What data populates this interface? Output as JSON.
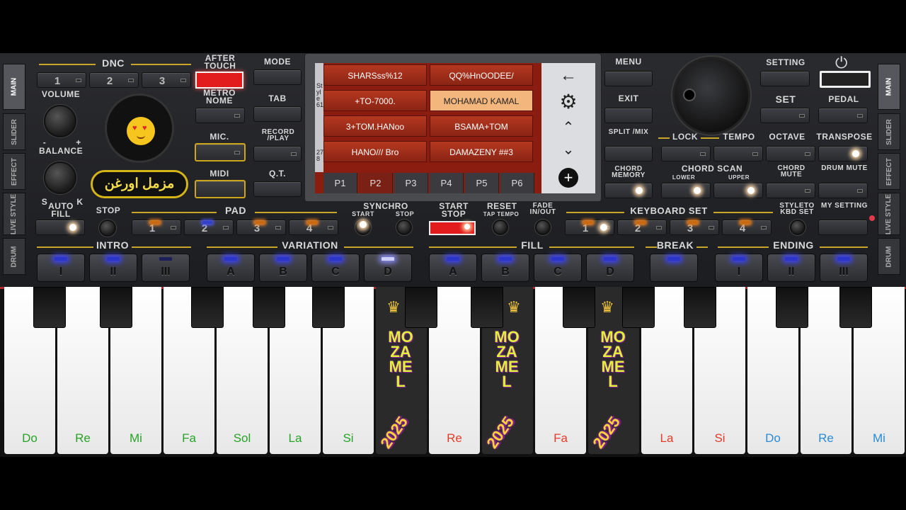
{
  "tabs_left": [
    "MAIN",
    "SLIDER",
    "EFFECT",
    "LIVE STYLE",
    "DRUM"
  ],
  "tabs_right": [
    "MAIN",
    "SLIDER",
    "EFFECT",
    "LIVE STYLE",
    "DRUM"
  ],
  "dnc": {
    "label": "DNC",
    "buttons": [
      "1",
      "2",
      "3"
    ]
  },
  "after_touch": "AFTER TOUCH",
  "volume": "VOLUME",
  "balance": "BALANCE",
  "metronome": "METRO NOME",
  "mic": "MIC.",
  "midi": "MIDI",
  "logo_text": "مزمل اورغن",
  "auto_fill": "AUTO FILL",
  "s_label": "S",
  "k_label": "K",
  "minus": "-",
  "plus": "+",
  "stop": "STOP",
  "pad": {
    "label": "PAD",
    "buttons": [
      "1",
      "2",
      "3",
      "4"
    ]
  },
  "mode_buttons": {
    "mode": "MODE",
    "tab": "TAB",
    "record": "RECORD /PLAY",
    "qt": "Q.T."
  },
  "display": {
    "style_label": "Style 61",
    "num_label": "278",
    "slots": [
      {
        "left": "SHARSss%12",
        "right": "QQ%HnOODEE/"
      },
      {
        "left": "+TO-7000.",
        "right": "MOHAMAD KAMAL"
      },
      {
        "left": "3+TOM.HANoo",
        "right": "BSAMA+TOM"
      },
      {
        "left": "HANO/// Bro",
        "right": "DAMAZENY ##3"
      }
    ],
    "pages": [
      "P1",
      "P2",
      "P3",
      "P4",
      "P5",
      "P6"
    ],
    "selected_page": "P2",
    "icons": [
      "back-arrow",
      "settings-gear",
      "up",
      "down",
      "add"
    ]
  },
  "menu_buttons": {
    "menu": "MENU",
    "exit": "EXIT",
    "split": "SPLIT /MIX",
    "chord_memory": "CHORD MEMORY"
  },
  "setting": "SETTING",
  "set": "SET",
  "pedal": "PEDAL",
  "lock": "LOCK",
  "tempo": "TEMPO",
  "octave": "OCTAVE",
  "transpose": "TRANSPOSE",
  "chord_scan": "CHORD SCAN",
  "lower": "LOWER",
  "upper": "UPPER",
  "chord_mute": "CHORD MUTE",
  "drum_mute": "DRUM MUTE",
  "synchro": {
    "label": "SYNCHRO",
    "start": "START",
    "stop": "STOP"
  },
  "start_stop": "START STOP",
  "reset": "RESET",
  "tap_tempo": "TAP TEMPO",
  "fade": "FADE IN/OUT",
  "keyboard_set": {
    "label": "KEYBOARD SET",
    "buttons": [
      "1",
      "2",
      "3",
      "4"
    ]
  },
  "style_to_kbd": "STYLETO KBD SET",
  "my_setting": "MY SETTING",
  "sections": {
    "intro": {
      "label": "INTRO",
      "buttons": [
        "I",
        "II",
        "III"
      ]
    },
    "variation": {
      "label": "VARIATION",
      "buttons": [
        "A",
        "B",
        "C",
        "D"
      ]
    },
    "fill": {
      "label": "FILL",
      "buttons": [
        "A",
        "B",
        "C",
        "D"
      ]
    },
    "break": {
      "label": "BREAK"
    },
    "ending": {
      "label": "ENDING",
      "buttons": [
        "I",
        "II",
        "III"
      ]
    }
  },
  "white_keys": [
    "Do",
    "Re",
    "Mi",
    "Fa",
    "Sol",
    "La",
    "Si",
    "",
    "Re",
    "",
    "Fa",
    "",
    "La",
    "Si",
    "Do",
    "Re",
    "Mi"
  ],
  "key_colors": {
    "green": "#27a327",
    "red": "#e53b2a",
    "blue": "#2a8bd6"
  },
  "watermark": {
    "text": "MOZAMEL",
    "year": "2025"
  }
}
